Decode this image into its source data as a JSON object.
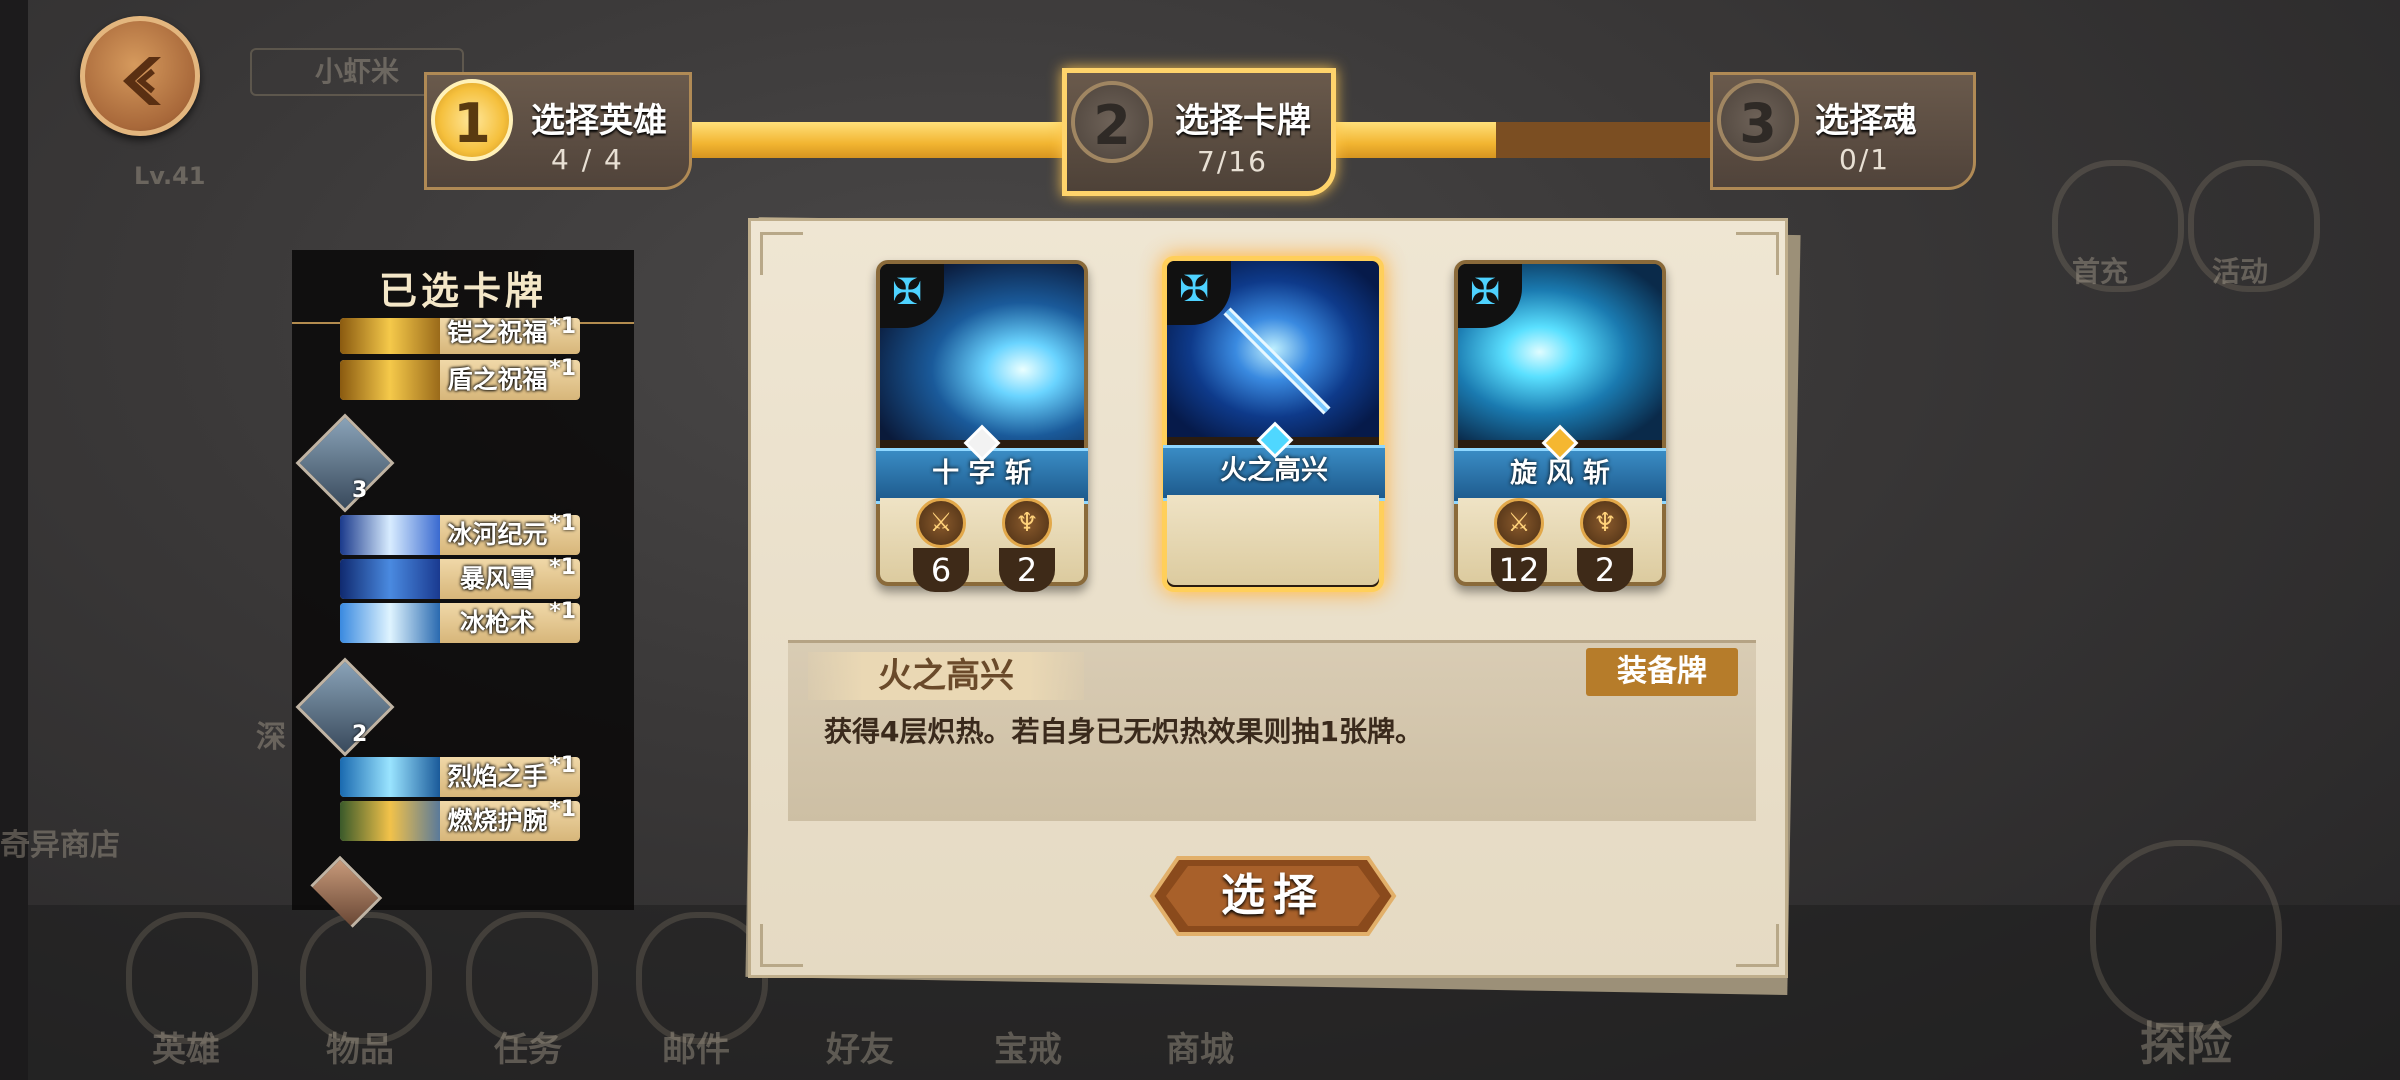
{
  "background": {
    "player_name": "小虾米",
    "player_level": "Lv.41",
    "side_labels": [
      "首充",
      "活动"
    ],
    "left_labels": [
      "奇异商店",
      "深"
    ],
    "bottom_nav": [
      "英雄",
      "物品",
      "任务",
      "邮件",
      "好友",
      "宝戒",
      "商城"
    ],
    "explore_label": "探险"
  },
  "steps": [
    {
      "num": "1",
      "title": "选择英雄",
      "count": "4 / 4",
      "state": "done"
    },
    {
      "num": "2",
      "title": "选择卡牌",
      "count": "7/16",
      "state": "active"
    },
    {
      "num": "3",
      "title": "选择魂",
      "count": "0/1",
      "state": "todo"
    }
  ],
  "progress_fraction": 0.76,
  "selected_panel": {
    "title": "已选卡牌",
    "items": [
      {
        "name": "铠之祝福",
        "qty": "*1",
        "kind": "gold"
      },
      {
        "name": "盾之祝福",
        "qty": "*1",
        "kind": "gold"
      },
      {
        "name": "冰河纪元",
        "qty": "*1",
        "kind": "ice"
      },
      {
        "name": "暴风雪",
        "qty": "*1",
        "kind": "ice"
      },
      {
        "name": "冰枪术",
        "qty": "*1",
        "kind": "ice"
      },
      {
        "name": "烈焰之手",
        "qty": "*1",
        "kind": "ice"
      },
      {
        "name": "燃烧护腕",
        "qty": "*1",
        "kind": "gold"
      }
    ],
    "hero_counts": [
      "3",
      "2"
    ]
  },
  "cards": [
    {
      "name": "十 字 斩",
      "attack": "6",
      "count": "2",
      "selected": false,
      "gem": "#f2f2f2"
    },
    {
      "name": "火之高兴",
      "selected": true,
      "gem": "#4fd7ff"
    },
    {
      "name": "旋 风 斩",
      "attack": "12",
      "count": "2",
      "selected": false,
      "gem": "#f5b731"
    }
  ],
  "description": {
    "title": "火之高兴",
    "tag": "装备牌",
    "text": "获得4层炽热。若自身已无炽热效果则抽1张牌。"
  },
  "select_button": "选择",
  "colors": {
    "gold": "#f2b531",
    "accent_blue": "#4ed2ff",
    "brown": "#7b4e22"
  }
}
